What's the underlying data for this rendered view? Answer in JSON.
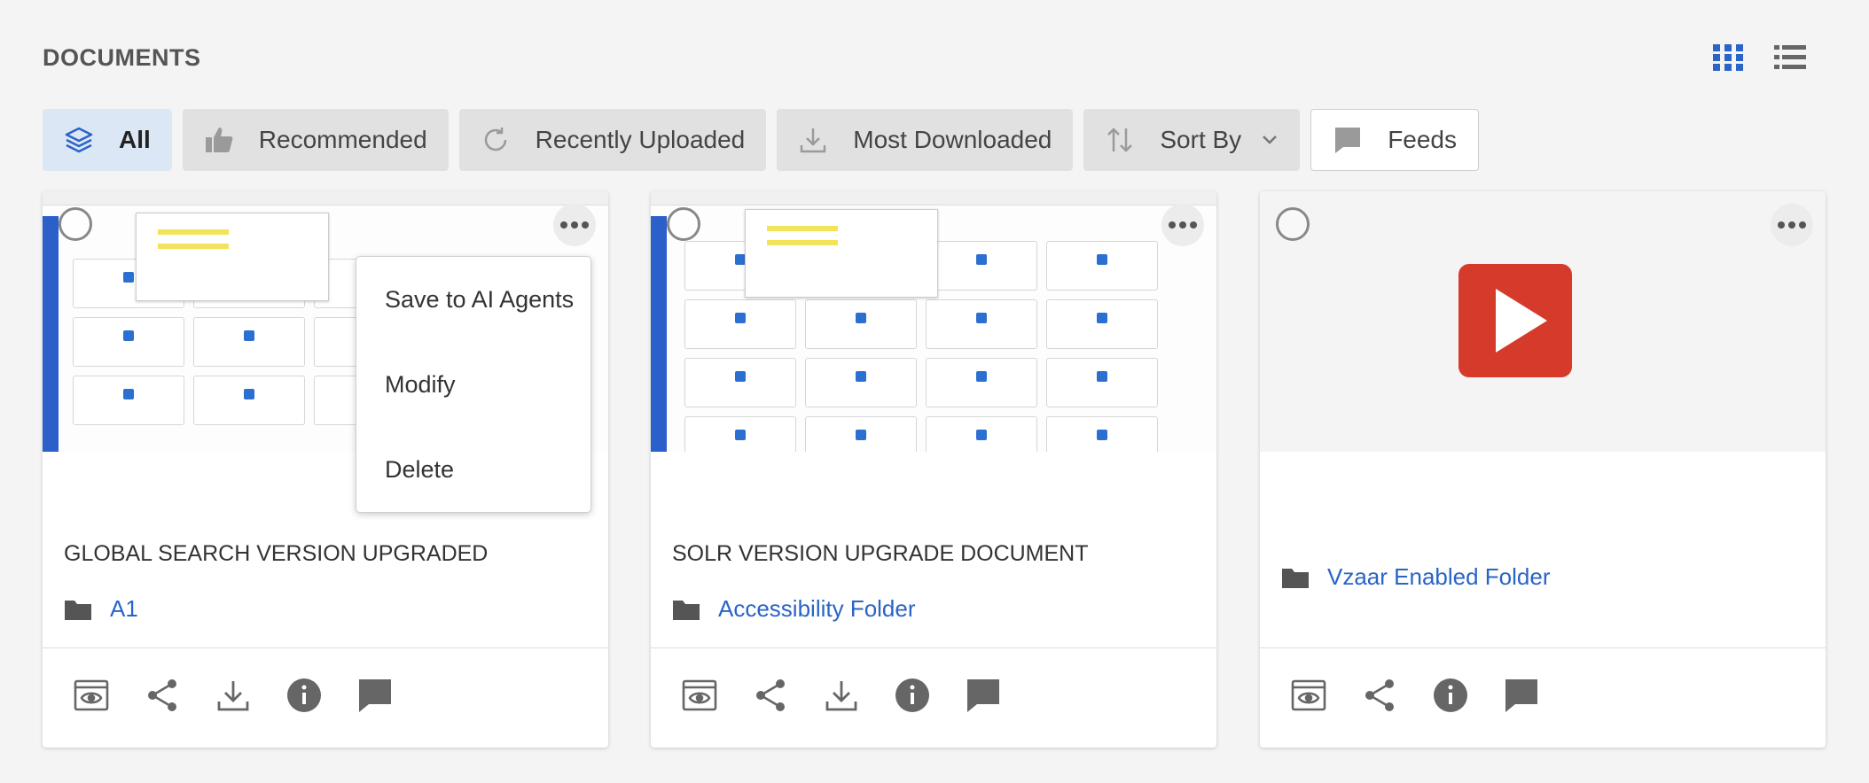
{
  "page": {
    "heading": "DOCUMENTS"
  },
  "filters": {
    "all": "All",
    "recommended": "Recommended",
    "recently_uploaded": "Recently Uploaded",
    "most_downloaded": "Most Downloaded",
    "sort_by": "Sort By",
    "feeds": "Feeds"
  },
  "colors": {
    "accent": "#2a64c6",
    "active_chip": "#dce7f6",
    "youtube_red": "#d63a2b"
  },
  "cards": [
    {
      "title": "GLOBAL SEARCH VERSION UPGRADED",
      "folder": "A1",
      "icons": [
        "view-icon",
        "share-icon",
        "download-icon",
        "info-icon",
        "comment-icon"
      ]
    },
    {
      "title": "SOLR VERSION UPGRADE DOCUMENT",
      "folder": "Accessibility Folder",
      "icons": [
        "view-icon",
        "share-icon",
        "download-icon",
        "info-icon",
        "comment-icon"
      ]
    },
    {
      "title": "",
      "folder": "Vzaar Enabled Folder",
      "icons": [
        "view-icon",
        "share-icon",
        "info-icon",
        "comment-icon"
      ]
    }
  ],
  "context_menu": {
    "items": [
      "Save to AI Agents",
      "Modify",
      "Delete"
    ]
  }
}
